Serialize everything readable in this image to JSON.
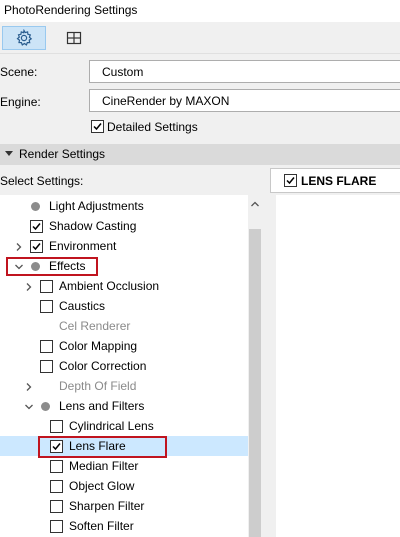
{
  "window": {
    "title": "PhotoRendering Settings"
  },
  "toolbar": {
    "buttons": [
      {
        "name": "settings",
        "icon": "gear-icon",
        "active": true
      },
      {
        "name": "size",
        "icon": "frame-crop-icon",
        "active": false
      }
    ]
  },
  "form": {
    "scene_label": "Scene:",
    "scene_value": "Custom",
    "engine_label": "Engine:",
    "engine_value": "CineRender by MAXON",
    "detailed_label": "Detailed Settings",
    "detailed_checked": true
  },
  "section": {
    "title": "Render Settings"
  },
  "select_label": "Select Settings:",
  "right_panel": {
    "title": "LENS FLARE",
    "checked": true
  },
  "tree": {
    "items": [
      {
        "label": "Light Adjustments",
        "type": "bullet",
        "indent": 0,
        "expander": null,
        "disabled": false
      },
      {
        "label": "Shadow Casting",
        "type": "checkbox",
        "checked": true,
        "indent": 0,
        "expander": null,
        "disabled": false
      },
      {
        "label": "Environment",
        "type": "checkbox",
        "checked": true,
        "indent": 0,
        "expander": "collapsed",
        "disabled": false
      },
      {
        "label": "Effects",
        "type": "bullet",
        "indent": 0,
        "expander": "expanded",
        "disabled": false,
        "highlighted": true
      },
      {
        "label": "Ambient Occlusion",
        "type": "checkbox",
        "checked": false,
        "indent": 1,
        "expander": "collapsed",
        "disabled": false
      },
      {
        "label": "Caustics",
        "type": "checkbox",
        "checked": false,
        "indent": 1,
        "expander": null,
        "disabled": false
      },
      {
        "label": "Cel Renderer",
        "type": "none",
        "indent": 1,
        "expander": null,
        "disabled": true
      },
      {
        "label": "Color Mapping",
        "type": "checkbox",
        "checked": false,
        "indent": 1,
        "expander": null,
        "disabled": false
      },
      {
        "label": "Color Correction",
        "type": "checkbox",
        "checked": false,
        "indent": 1,
        "expander": null,
        "disabled": false
      },
      {
        "label": "Depth Of Field",
        "type": "none",
        "indent": 1,
        "expander": "collapsed",
        "disabled": true
      },
      {
        "label": "Lens and Filters",
        "type": "bullet",
        "indent": 1,
        "expander": "expanded",
        "disabled": false
      },
      {
        "label": "Cylindrical Lens",
        "type": "checkbox",
        "checked": false,
        "indent": 2,
        "expander": null,
        "disabled": false
      },
      {
        "label": "Lens Flare",
        "type": "checkbox",
        "checked": true,
        "indent": 2,
        "expander": null,
        "disabled": false,
        "selected": true,
        "highlighted": true
      },
      {
        "label": "Median Filter",
        "type": "checkbox",
        "checked": false,
        "indent": 2,
        "expander": null,
        "disabled": false
      },
      {
        "label": "Object Glow",
        "type": "checkbox",
        "checked": false,
        "indent": 2,
        "expander": null,
        "disabled": false
      },
      {
        "label": "Sharpen Filter",
        "type": "checkbox",
        "checked": false,
        "indent": 2,
        "expander": null,
        "disabled": false
      },
      {
        "label": "Soften Filter",
        "type": "checkbox",
        "checked": false,
        "indent": 2,
        "expander": null,
        "disabled": false
      }
    ]
  },
  "colors": {
    "highlight_border": "#c0141f",
    "selection": "#cce8ff",
    "active_tool": "#cce4f7"
  }
}
